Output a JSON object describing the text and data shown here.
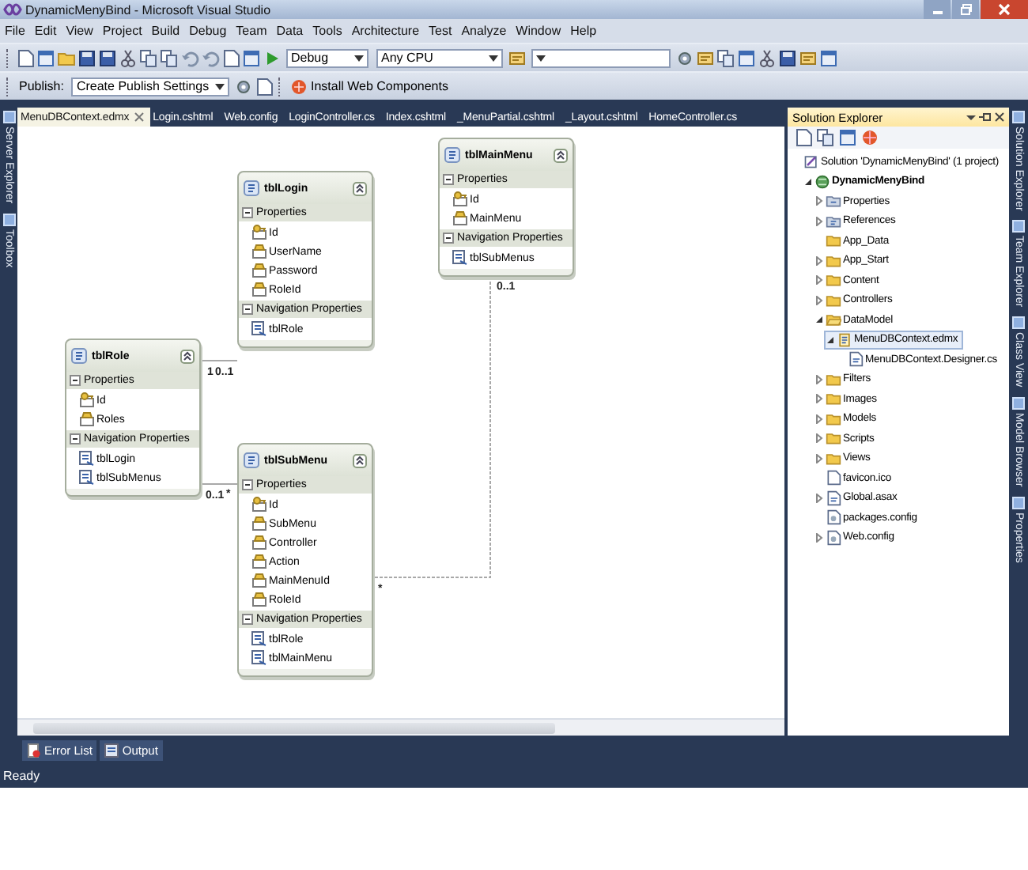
{
  "window": {
    "title": "DynamicMenyBind - Microsoft Visual Studio"
  },
  "menu_bar": [
    "File",
    "Edit",
    "View",
    "Project",
    "Build",
    "Debug",
    "Team",
    "Data",
    "Tools",
    "Architecture",
    "Test",
    "Analyze",
    "Window",
    "Help"
  ],
  "toolbar": {
    "configuration": "Debug",
    "platform": "Any CPU"
  },
  "publish_bar": {
    "label": "Publish:",
    "profile": "Create Publish Settings",
    "install_button": "Install Web Components"
  },
  "left_dock": [
    "Server Explorer",
    "Toolbox"
  ],
  "document_tabs": [
    {
      "label": "MenuDBContext.edmx",
      "selected": true
    },
    {
      "label": "Login.cshtml",
      "selected": false
    },
    {
      "label": "Web.config",
      "selected": false
    },
    {
      "label": "LoginController.cs",
      "selected": false
    },
    {
      "label": "Index.cshtml",
      "selected": false
    },
    {
      "label": "_MenuPartial.cshtml",
      "selected": false
    },
    {
      "label": "_Layout.cshtml",
      "selected": false
    },
    {
      "label": "HomeController.cs",
      "selected": false
    }
  ],
  "diagram": {
    "entities": [
      {
        "name": "tblLogin",
        "properties_heading": "Properties",
        "properties": [
          {
            "name": "Id",
            "key": true
          },
          {
            "name": "UserName",
            "key": false
          },
          {
            "name": "Password",
            "key": false
          },
          {
            "name": "RoleId",
            "key": false
          }
        ],
        "navigation_heading": "Navigation Properties",
        "navigation_properties": [
          "tblRole"
        ]
      },
      {
        "name": "tblMainMenu",
        "properties_heading": "Properties",
        "properties": [
          {
            "name": "Id",
            "key": true
          },
          {
            "name": "MainMenu",
            "key": false
          }
        ],
        "navigation_heading": "Navigation Properties",
        "navigation_properties": [
          "tblSubMenus"
        ]
      },
      {
        "name": "tblRole",
        "properties_heading": "Properties",
        "properties": [
          {
            "name": "Id",
            "key": true
          },
          {
            "name": "Roles",
            "key": false
          }
        ],
        "navigation_heading": "Navigation Properties",
        "navigation_properties": [
          "tblLogin",
          "tblSubMenus"
        ]
      },
      {
        "name": "tblSubMenu",
        "properties_heading": "Properties",
        "properties": [
          {
            "name": "Id",
            "key": true
          },
          {
            "name": "SubMenu",
            "key": false
          },
          {
            "name": "Controller",
            "key": false
          },
          {
            "name": "Action",
            "key": false
          },
          {
            "name": "MainMenuId",
            "key": false
          },
          {
            "name": "RoleId",
            "key": false
          }
        ],
        "navigation_heading": "Navigation Properties",
        "navigation_properties": [
          "tblRole",
          "tblMainMenu"
        ]
      }
    ],
    "associations": [
      {
        "from_label": "1",
        "to_label": "0..1"
      },
      {
        "from_label": "0..1",
        "to_label": "*"
      },
      {
        "from_label": "0..1",
        "to_label": "*"
      }
    ]
  },
  "solution_explorer": {
    "title": "Solution Explorer",
    "tree": [
      {
        "label": "Solution 'DynamicMenyBind' (1 project)",
        "kind": "solution",
        "selected": false,
        "children": [
          {
            "label": "DynamicMenyBind",
            "kind": "project",
            "expanded": true,
            "selected": false,
            "children": [
              {
                "label": "Properties",
                "kind": "properties",
                "expanded": false,
                "selected": false
              },
              {
                "label": "References",
                "kind": "references",
                "expanded": false,
                "selected": false
              },
              {
                "label": "App_Data",
                "kind": "folder",
                "selected": false
              },
              {
                "label": "App_Start",
                "kind": "folder",
                "expanded": false,
                "selected": false
              },
              {
                "label": "Content",
                "kind": "folder",
                "expanded": false,
                "selected": false
              },
              {
                "label": "Controllers",
                "kind": "folder",
                "expanded": false,
                "selected": false
              },
              {
                "label": "DataModel",
                "kind": "open-folder",
                "expanded": true,
                "selected": false,
                "children": [
                  {
                    "label": "MenuDBContext.edmx",
                    "kind": "model",
                    "expanded": true,
                    "selected": true,
                    "children": [
                      {
                        "label": "MenuDBContext.Designer.cs",
                        "kind": "code",
                        "selected": false
                      }
                    ]
                  }
                ]
              },
              {
                "label": "Filters",
                "kind": "folder",
                "expanded": false,
                "selected": false
              },
              {
                "label": "Images",
                "kind": "folder",
                "expanded": false,
                "selected": false
              },
              {
                "label": "Models",
                "kind": "folder",
                "expanded": false,
                "selected": false
              },
              {
                "label": "Scripts",
                "kind": "folder",
                "expanded": false,
                "selected": false
              },
              {
                "label": "Views",
                "kind": "folder",
                "expanded": false,
                "selected": false
              },
              {
                "label": "favicon.ico",
                "kind": "file",
                "selected": false
              },
              {
                "label": "Global.asax",
                "kind": "code",
                "expanded": false,
                "selected": false
              },
              {
                "label": "packages.config",
                "kind": "config",
                "selected": false
              },
              {
                "label": "Web.config",
                "kind": "config",
                "expanded": false,
                "selected": false
              }
            ]
          }
        ]
      }
    ]
  },
  "right_dock": [
    "Solution Explorer",
    "Team Explorer",
    "Class View",
    "Model Browser",
    "Properties"
  ],
  "bottom_tabs": [
    "Error List",
    "Output"
  ],
  "status_bar": {
    "text": "Ready"
  }
}
